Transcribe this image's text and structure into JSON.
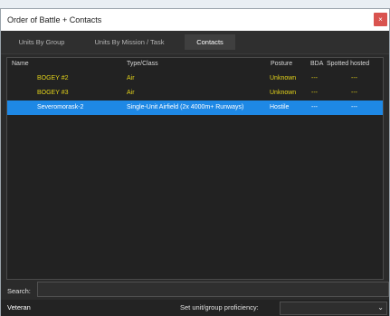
{
  "window": {
    "title": "Order of Battle + Contacts",
    "close_glyph": "×"
  },
  "tabs": [
    {
      "label": "Units By Group"
    },
    {
      "label": "Units By Mission / Task"
    },
    {
      "label": "Contacts",
      "active": true
    }
  ],
  "grid": {
    "headers": {
      "name": "Name",
      "type": "Type/Class",
      "posture": "Posture",
      "bda": "BDA",
      "spotted": "Spotted hosted"
    },
    "rows": [
      {
        "name": "BOGEY #2",
        "type": "Air",
        "posture": "Unknown",
        "bda": "---",
        "spotted": "---"
      },
      {
        "name": "BOGEY #3",
        "type": "Air",
        "posture": "Unknown",
        "bda": "---",
        "spotted": "---"
      },
      {
        "name": "Severomorask-2",
        "type": "Single-Unit Airfield (2x 4000m+ Runways)",
        "posture": "Hostile",
        "bda": "---",
        "spotted": "---"
      }
    ]
  },
  "search": {
    "label": "Search:",
    "value": ""
  },
  "footer": {
    "proficiency_value": "Veteran",
    "proficiency_label": "Set unit/group proficiency:",
    "dropdown_icon": "chevron-down-icon"
  },
  "colors": {
    "selection": "#1e88e5",
    "contact_unknown": "#e3d21a",
    "close": "#d9534f"
  }
}
